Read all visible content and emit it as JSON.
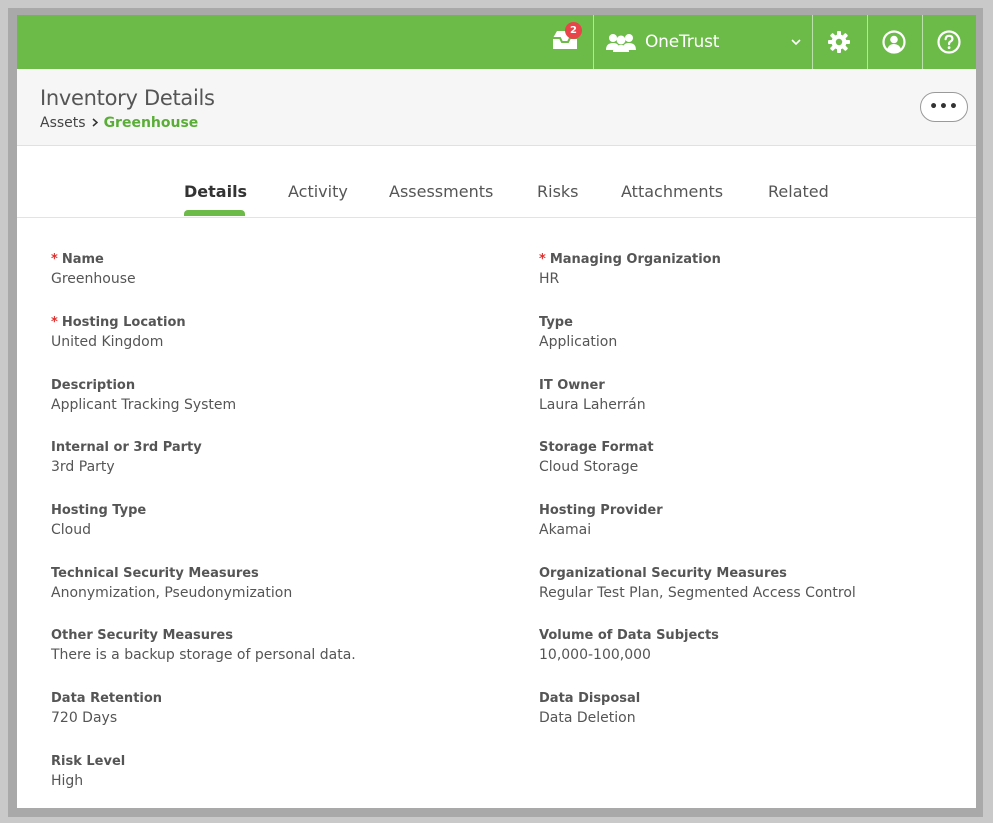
{
  "topbar": {
    "inbox_badge": "2",
    "org_name": "OneTrust",
    "colors": {
      "bar": "#6cbb48",
      "badge": "#e8454a"
    },
    "icons": [
      "inbox-icon",
      "users-group-icon",
      "chevron-down-icon",
      "gear-icon",
      "user-circle-icon",
      "help-icon"
    ]
  },
  "header": {
    "title": "Inventory Details",
    "breadcrumb": {
      "parent": "Assets",
      "current": "Greenhouse"
    },
    "more_label": "•••"
  },
  "tabs": [
    {
      "label": "Details",
      "active": true
    },
    {
      "label": "Activity"
    },
    {
      "label": "Assessments"
    },
    {
      "label": "Risks"
    },
    {
      "label": "Attachments"
    },
    {
      "label": "Related"
    }
  ],
  "fields": {
    "left": [
      {
        "label": "Name",
        "value": "Greenhouse",
        "required": "*"
      },
      {
        "label": "Hosting Location",
        "value": "United Kingdom",
        "required": "*"
      },
      {
        "label": "Description",
        "value": "Applicant Tracking System"
      },
      {
        "label": "Internal or 3rd Party",
        "value": "3rd Party"
      },
      {
        "label": "Hosting Type",
        "value": "Cloud"
      },
      {
        "label": "Technical Security Measures",
        "value": "Anonymization, Pseudonymization"
      },
      {
        "label": "Other Security Measures",
        "value": "There is a backup storage of personal data."
      },
      {
        "label": "Data Retention",
        "value": "720 Days"
      },
      {
        "label": "Risk Level",
        "value": "High"
      }
    ],
    "right": [
      {
        "label": "Managing Organization",
        "value": "HR",
        "required": "*"
      },
      {
        "label": "Type",
        "value": "Application"
      },
      {
        "label": "IT Owner",
        "value": "Laura Laherrán"
      },
      {
        "label": "Storage Format",
        "value": "Cloud Storage"
      },
      {
        "label": "Hosting Provider",
        "value": "Akamai"
      },
      {
        "label": "Organizational Security Measures",
        "value": "Regular Test Plan, Segmented Access Control"
      },
      {
        "label": "Volume of Data Subjects",
        "value": "10,000-100,000"
      },
      {
        "label": "Data Disposal",
        "value": "Data Deletion"
      }
    ]
  }
}
